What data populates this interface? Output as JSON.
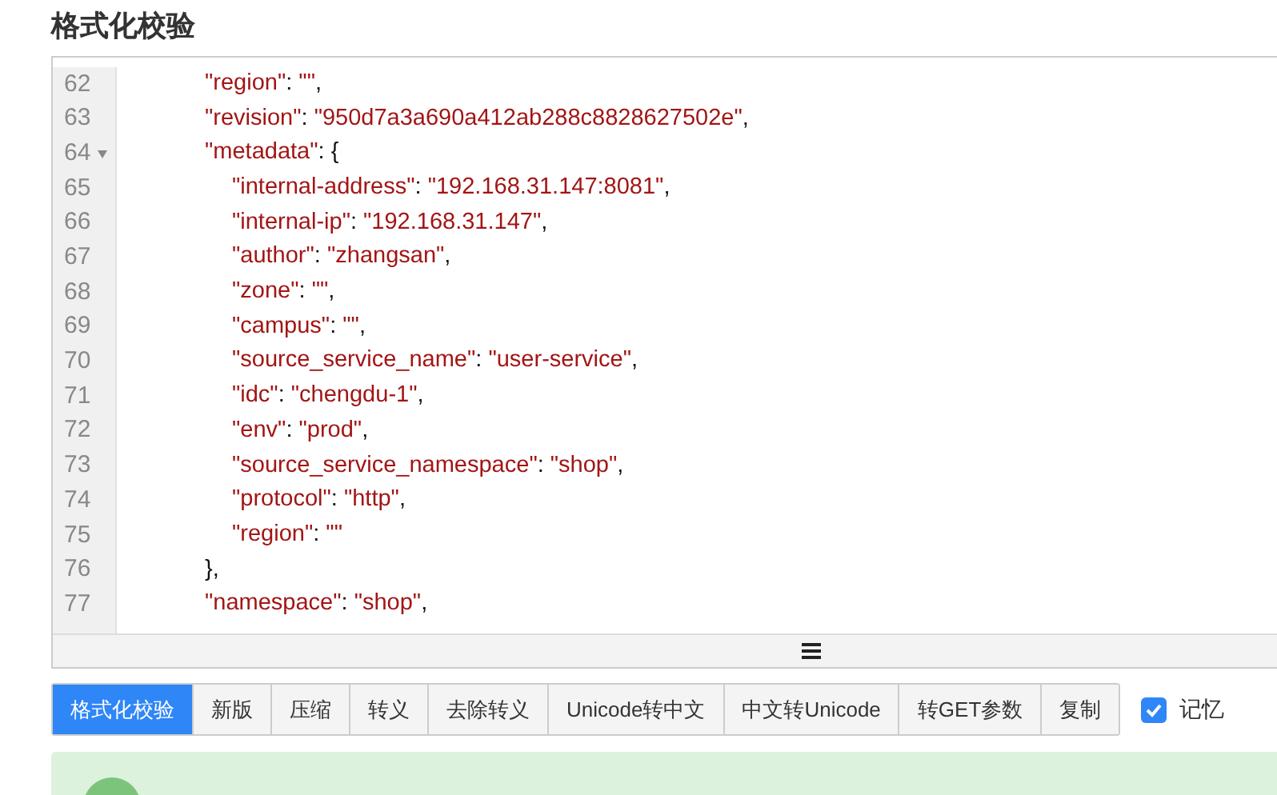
{
  "title": "格式化校验",
  "editor": {
    "lines": [
      {
        "number": "62",
        "text": "\"region\": \"\","
      },
      {
        "number": "63",
        "text": "\"revision\": \"950d7a3a690a412ab288c8828627502e\","
      },
      {
        "number": "64",
        "text": "\"metadata\": {",
        "expanded": true,
        "children": [
          {
            "number": "65",
            "text": "\"internal-address\": \"192.168.31.147:8081\","
          },
          {
            "number": "66",
            "text": "\"internal-ip\": \"192.168.31.147\","
          },
          {
            "number": "67",
            "text": "\"author\": \"zhangsan\","
          },
          {
            "number": "68",
            "text": "\"zone\": \"\","
          },
          {
            "number": "69",
            "text": "\"campus\": \"\","
          },
          {
            "number": "70",
            "text": "\"source_service_name\": \"user-service\","
          },
          {
            "number": "71",
            "text": "\"idc\": \"chengdu-1\","
          },
          {
            "number": "72",
            "text": "\"env\": \"prod\","
          },
          {
            "number": "73",
            "text": "\"source_service_namespace\": \"shop\","
          },
          {
            "number": "74",
            "text": "\"protocol\": \"http\","
          },
          {
            "number": "75",
            "text": "\"region\": \"\""
          }
        ]
      },
      {
        "number": "76",
        "text": "},"
      },
      {
        "number": "77",
        "text": "\"namespace\": \"shop\","
      }
    ]
  },
  "buttons": [
    {
      "label": "格式化校验",
      "selected": true
    },
    {
      "label": "新版",
      "selected": false
    },
    {
      "label": "压缩",
      "selected": false
    },
    {
      "label": "转义",
      "selected": false
    },
    {
      "label": "去除转义",
      "selected": false
    },
    {
      "label": "Unicode转中文",
      "selected": false
    },
    {
      "label": "中文转Unicode",
      "selected": false
    },
    {
      "label": "转GET参数",
      "selected": false
    },
    {
      "label": "复制",
      "selected": false
    }
  ],
  "remember": {
    "label": "记忆",
    "checked": true
  }
}
